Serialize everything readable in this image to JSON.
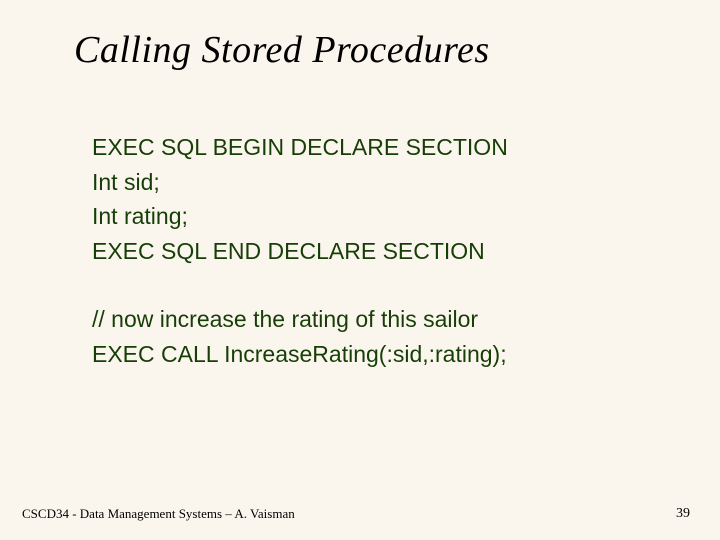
{
  "title": "Calling Stored Procedures",
  "code": {
    "l1": "EXEC SQL BEGIN DECLARE SECTION",
    "l2": "Int sid;",
    "l3": "Int rating;",
    "l4": "EXEC SQL END DECLARE SECTION",
    "l5": "// now increase the rating of this sailor",
    "l6": "EXEC CALL IncreaseRating(:sid,:rating);"
  },
  "footer": {
    "left": "CSCD34 - Data Management Systems – A. Vaisman",
    "right": "39"
  }
}
